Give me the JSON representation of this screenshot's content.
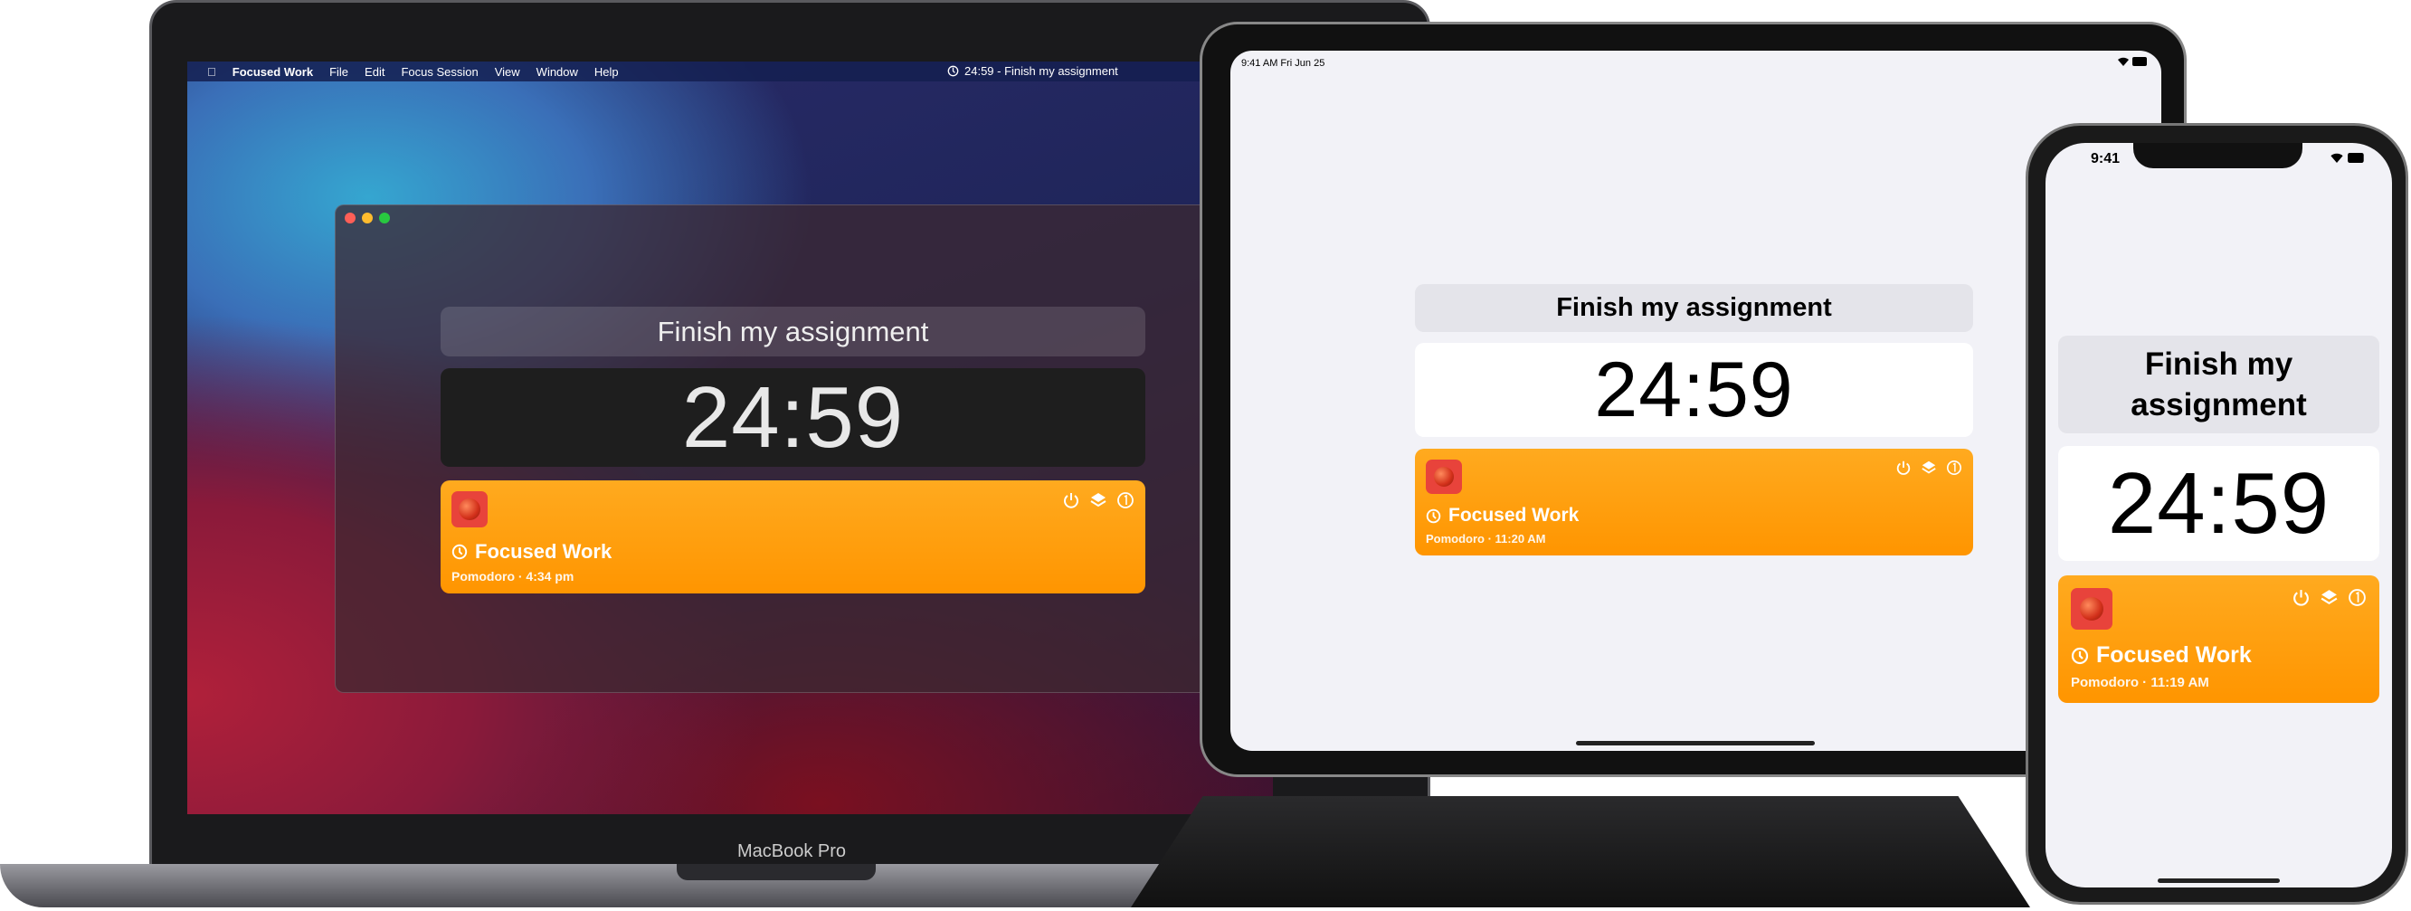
{
  "mac": {
    "menubar": {
      "app": "Focused Work",
      "items": [
        "File",
        "Edit",
        "Focus Session",
        "View",
        "Window",
        "Help"
      ],
      "status": "24:59 - Finish my assignment"
    },
    "title": "Finish my assignment",
    "timer": "24:59",
    "card": {
      "name": "Focused Work",
      "subtitle": "Pomodoro · 4:34 pm"
    },
    "device_label": "MacBook Pro"
  },
  "ipad": {
    "status_time": "9:41 AM  Fri Jun 25",
    "title": "Finish my assignment",
    "timer": "24:59",
    "card": {
      "name": "Focused Work",
      "subtitle": "Pomodoro · 11:20 AM"
    }
  },
  "iphone": {
    "status_time": "9:41",
    "title": "Finish my assignment",
    "timer": "24:59",
    "card": {
      "name": "Focused Work",
      "subtitle": "Pomodoro · 11:19 AM"
    }
  },
  "colors": {
    "card": "#ff9500",
    "app_icon": "#e8433b",
    "ios_bg": "#f2f2f7"
  },
  "icons": [
    "apple-icon",
    "timer-icon",
    "power-icon",
    "layers-icon",
    "number-one-circle-icon",
    "wifi-icon",
    "battery-icon",
    "tomato-icon"
  ]
}
